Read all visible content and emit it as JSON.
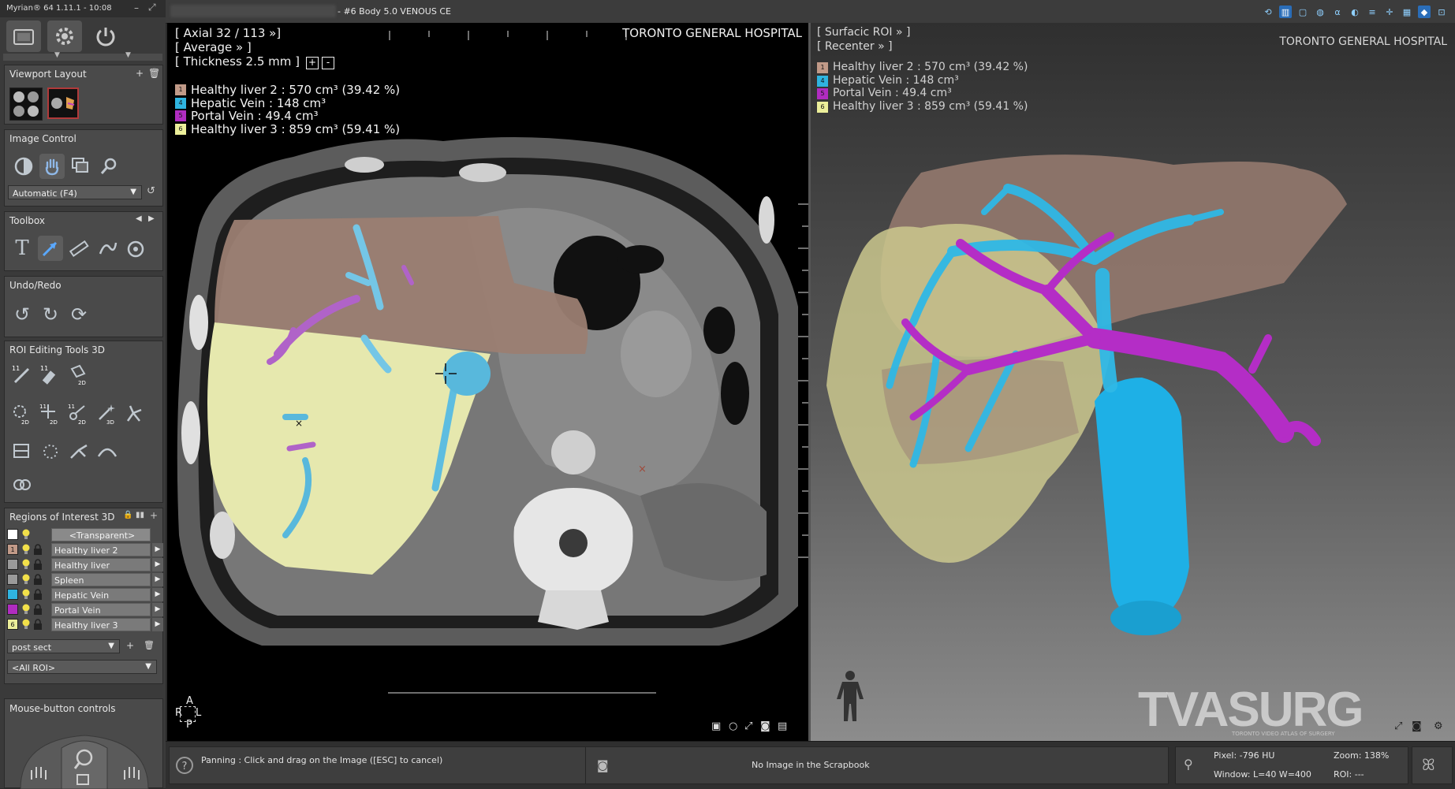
{
  "app": {
    "title": "Myrian® 64 1.11.1 - 10:08"
  },
  "top_bar": {
    "series_title": "- #6 Body 5.0 VENOUS CE"
  },
  "left_panel": {
    "viewport_layout": {
      "title": "Viewport Layout"
    },
    "image_control": {
      "title": "Image Control",
      "preset_value": "Automatic (F4)"
    },
    "toolbox": {
      "title": "Toolbox"
    },
    "undo_redo": {
      "title": "Undo/Redo"
    },
    "roi_editing": {
      "title": "ROI Editing Tools 3D",
      "badge_11": "11",
      "badge_2d": "2D",
      "badge_3d": "3D"
    },
    "regions": {
      "title": "Regions of Interest 3D",
      "items": [
        {
          "label": "<Transparent>",
          "color": "#ffffff",
          "num": ""
        },
        {
          "label": "Healthy liver 2",
          "color": "#c19a88",
          "num": "1"
        },
        {
          "label": "Healthy liver",
          "color": "#9a9a9a",
          "num": ""
        },
        {
          "label": "Spleen",
          "color": "#9a9a9a",
          "num": ""
        },
        {
          "label": "Hepatic Vein",
          "color": "#2fb4e0",
          "num": ""
        },
        {
          "label": "Portal Vein",
          "color": "#b02cc0",
          "num": ""
        },
        {
          "label": "Healthy liver 3",
          "color": "#ecef9a",
          "num": "6"
        }
      ],
      "set_value": "post sect",
      "filter_value": "<All ROI>"
    },
    "mouse_controls": {
      "title": "Mouse-button controls"
    }
  },
  "viewport_ct": {
    "hospital": "TORONTO GENERAL HOSPITAL",
    "slice": "[ Axial 32 / 113 »]",
    "mode": "[ Average » ]",
    "thickness": "[ Thickness 2.5 mm ]",
    "plus": "+",
    "minus": "-",
    "orientation": {
      "anterior": "A",
      "right": "R",
      "left": "L",
      "posterior": "P"
    },
    "legend": [
      {
        "num": "1",
        "color": "#c19a88",
        "text": "Healthy liver 2 : 570 cm³ (39.42 %)"
      },
      {
        "num": "4",
        "color": "#2fb4e0",
        "text": "Hepatic Vein : 148 cm³"
      },
      {
        "num": "5",
        "color": "#b02cc0",
        "text": "Portal Vein : 49.4 cm³"
      },
      {
        "num": "6",
        "color": "#ecef9a",
        "text": "Healthy liver 3 : 859 cm³ (59.41 %)"
      }
    ]
  },
  "viewport_3d": {
    "hospital": "TORONTO GENERAL HOSPITAL",
    "roi_mode": "[ Surfacic ROI » ]",
    "recenter": "[ Recenter » ]",
    "legend": [
      {
        "num": "1",
        "color": "#c19a88",
        "text": "Healthy liver 2 : 570 cm³ (39.42 %)"
      },
      {
        "num": "4",
        "color": "#2fb4e0",
        "text": "Hepatic Vein : 148 cm³"
      },
      {
        "num": "5",
        "color": "#b02cc0",
        "text": "Portal Vein : 49.4 cm³"
      },
      {
        "num": "6",
        "color": "#ecef9a",
        "text": "Healthy liver 3 : 859 cm³ (59.41 %)"
      }
    ],
    "watermark": "TVASURG",
    "watermark_sub": "TORONTO VIDEO ATLAS OF SURGERY"
  },
  "status_bar": {
    "hint": "Panning : Click and drag on the Image ([ESC] to cancel)",
    "scrapbook": "No Image in the Scrapbook",
    "pixel": "Pixel: -796 HU",
    "window": "Window: L=40 W=400",
    "zoom": "Zoom: 138%",
    "roi": "ROI: ---"
  },
  "colors": {
    "liver2": "#c19a88",
    "hepatic_vein": "#2fb4e0",
    "portal_vein": "#b02cc0",
    "liver3": "#ecef9a"
  }
}
